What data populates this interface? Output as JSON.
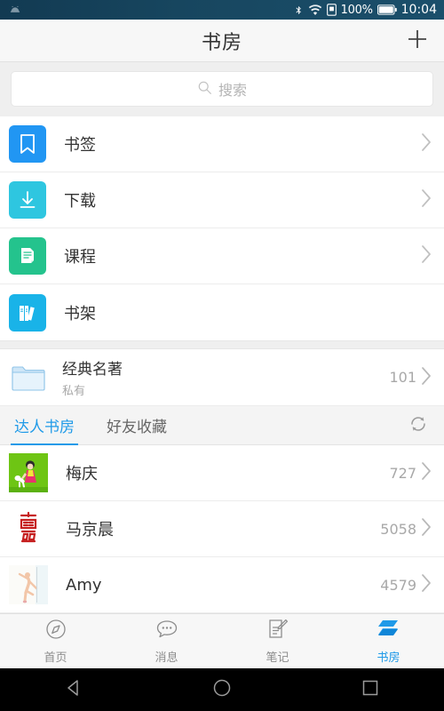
{
  "statusbar": {
    "left_icon": "android-notification-icon",
    "icons": [
      "bluetooth-icon",
      "wifi-icon",
      "sim-icon"
    ],
    "battery_percent": "100%",
    "battery_icon": "battery-full-icon",
    "clock": "10:04"
  },
  "header": {
    "title": "书房",
    "add_icon": "plus-icon"
  },
  "search": {
    "icon": "search-icon",
    "placeholder": "搜索",
    "value": ""
  },
  "menu": {
    "items": [
      {
        "label": "书签",
        "icon": "bookmark-icon",
        "color": "#2196f3",
        "chevron": true
      },
      {
        "label": "下载",
        "icon": "download-icon",
        "color": "#2ec6e0",
        "chevron": true
      },
      {
        "label": "课程",
        "icon": "course-document-icon",
        "color": "#24c38d",
        "chevron": true
      },
      {
        "label": "书架",
        "icon": "bookshelf-icon",
        "color": "#19b3e8",
        "chevron": false
      }
    ]
  },
  "folder": {
    "icon": "folder-icon",
    "title": "经典名著",
    "subtitle": "私有",
    "count": "101",
    "chevron_icon": "chevron-right-icon"
  },
  "tabs": {
    "items": [
      {
        "label": "达人书房",
        "active": true
      },
      {
        "label": "好友收藏",
        "active": false
      }
    ],
    "refresh_icon": "refresh-icon"
  },
  "people": {
    "items": [
      {
        "name": "梅庆",
        "count": "727",
        "avatar": "girl-with-dog-avatar"
      },
      {
        "name": "马京晨",
        "count": "5058",
        "avatar": "red-seal-avatar"
      },
      {
        "name": "Amy",
        "count": "4579",
        "avatar": "ballerina-avatar"
      }
    ]
  },
  "bottomnav": {
    "items": [
      {
        "label": "首页",
        "icon": "compass-icon",
        "active": false
      },
      {
        "label": "消息",
        "icon": "chat-bubble-icon",
        "active": false
      },
      {
        "label": "笔记",
        "icon": "note-edit-icon",
        "active": false
      },
      {
        "label": "书房",
        "icon": "books-stack-icon",
        "active": true
      }
    ]
  },
  "systembar": {
    "back_icon": "back-triangle-icon",
    "home_icon": "home-circle-icon",
    "recents_icon": "recents-square-icon"
  },
  "colors": {
    "accent": "#1f9ae8",
    "statusbar_bg": "#17465f",
    "page_bg": "#efefef",
    "muted_text": "#a8a8a8"
  }
}
